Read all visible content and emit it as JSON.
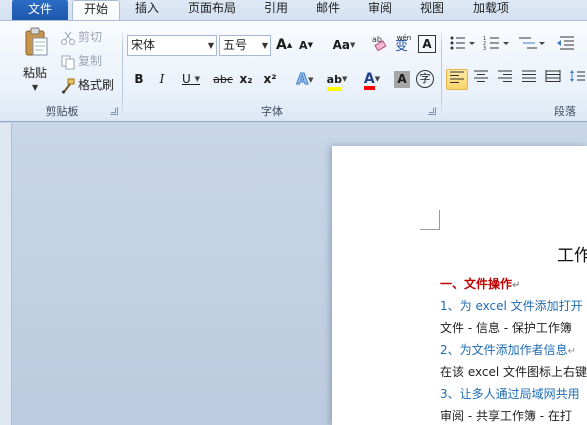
{
  "tabs": {
    "file": "文件",
    "items": [
      "开始",
      "插入",
      "页面布局",
      "引用",
      "邮件",
      "审阅",
      "视图",
      "加载项"
    ]
  },
  "clipboard": {
    "paste_label": "粘贴",
    "cut_label": "剪切",
    "copy_label": "复制",
    "format_painter_label": "格式刷",
    "group_label": "剪贴板"
  },
  "font": {
    "family_value": "宋体",
    "size_value": "五号",
    "grow_label": "A",
    "shrink_label": "A",
    "case_label": "Aa",
    "phonetic_label": "wén",
    "phonetic_char": "变",
    "border_label": "A",
    "bold_label": "B",
    "italic_label": "I",
    "underline_label": "U",
    "strike_label": "abc",
    "subscript_label": "x₂",
    "superscript_label": "x²",
    "effects_label": "A",
    "highlight_label": "ab",
    "color_label": "A",
    "shading_label": "A",
    "enclose_label": "字",
    "group_label": "字体"
  },
  "paragraph": {
    "group_label": "段落"
  },
  "colors": {
    "accent": "#1d58ad",
    "highlight_yellow": "#ffff00",
    "font_red": "#ff0000",
    "heading_red": "#c00000",
    "link_blue": "#1f6cb3"
  },
  "document": {
    "title": "工作",
    "lines": [
      {
        "text": "一、文件操作",
        "style": "red"
      },
      {
        "text": "1、为 excel 文件添加打开",
        "style": "blue"
      },
      {
        "text": "文件 - 信息 - 保护工作簿",
        "style": "black"
      },
      {
        "text": "2、为文件添加作者信息",
        "style": "blue"
      },
      {
        "text": "在该 excel 文件图标上右键",
        "style": "black"
      },
      {
        "text": "3、让多人通过局域网共用",
        "style": "blue"
      },
      {
        "text": "审阅 - 共享工作簿 - 在打",
        "style": "black"
      }
    ]
  }
}
